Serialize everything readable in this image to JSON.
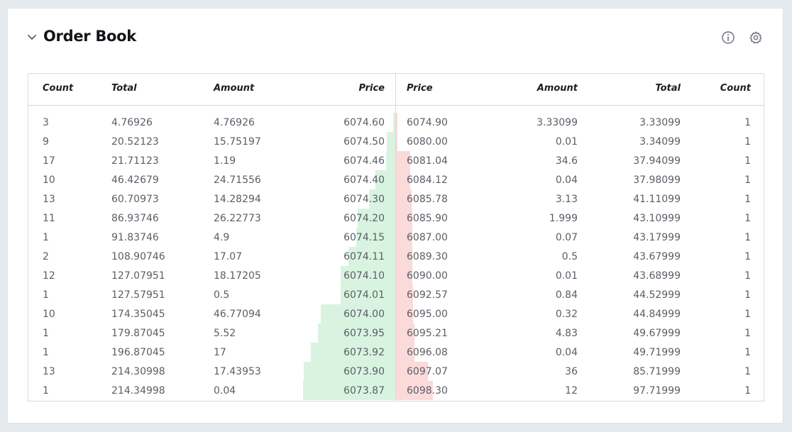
{
  "title": "Order Book",
  "icons": {
    "collapse": "chevron-down-icon",
    "info": "info-icon",
    "settings": "gear-icon"
  },
  "colors": {
    "bid_bar": "#d9f3e1",
    "ask_bar": "#fbdada",
    "accent": "#121418"
  },
  "bids": {
    "headers": [
      "Count",
      "Total",
      "Amount",
      "Price"
    ],
    "rows": [
      {
        "count": "3",
        "total": "4.76926",
        "amount": "4.76926",
        "price": "6074.60"
      },
      {
        "count": "9",
        "total": "20.52123",
        "amount": "15.75197",
        "price": "6074.50"
      },
      {
        "count": "17",
        "total": "21.71123",
        "amount": "1.19",
        "price": "6074.46"
      },
      {
        "count": "10",
        "total": "46.42679",
        "amount": "24.71556",
        "price": "6074.40"
      },
      {
        "count": "13",
        "total": "60.70973",
        "amount": "14.28294",
        "price": "6074.30"
      },
      {
        "count": "11",
        "total": "86.93746",
        "amount": "26.22773",
        "price": "6074.20"
      },
      {
        "count": "1",
        "total": "91.83746",
        "amount": "4.9",
        "price": "6074.15"
      },
      {
        "count": "2",
        "total": "108.90746",
        "amount": "17.07",
        "price": "6074.11"
      },
      {
        "count": "12",
        "total": "127.07951",
        "amount": "18.17205",
        "price": "6074.10"
      },
      {
        "count": "1",
        "total": "127.57951",
        "amount": "0.5",
        "price": "6074.01"
      },
      {
        "count": "10",
        "total": "174.35045",
        "amount": "46.77094",
        "price": "6074.00"
      },
      {
        "count": "1",
        "total": "179.87045",
        "amount": "5.52",
        "price": "6073.95"
      },
      {
        "count": "1",
        "total": "196.87045",
        "amount": "17",
        "price": "6073.92"
      },
      {
        "count": "13",
        "total": "214.30998",
        "amount": "17.43953",
        "price": "6073.90"
      },
      {
        "count": "1",
        "total": "214.34998",
        "amount": "0.04",
        "price": "6073.87"
      }
    ]
  },
  "asks": {
    "headers": [
      "Price",
      "Amount",
      "Total",
      "Count"
    ],
    "rows": [
      {
        "price": "6074.90",
        "amount": "3.33099",
        "total": "3.33099",
        "count": "1"
      },
      {
        "price": "6080.00",
        "amount": "0.01",
        "total": "3.34099",
        "count": "1"
      },
      {
        "price": "6081.04",
        "amount": "34.6",
        "total": "37.94099",
        "count": "1"
      },
      {
        "price": "6084.12",
        "amount": "0.04",
        "total": "37.98099",
        "count": "1"
      },
      {
        "price": "6085.78",
        "amount": "3.13",
        "total": "41.11099",
        "count": "1"
      },
      {
        "price": "6085.90",
        "amount": "1.999",
        "total": "43.10999",
        "count": "1"
      },
      {
        "price": "6087.00",
        "amount": "0.07",
        "total": "43.17999",
        "count": "1"
      },
      {
        "price": "6089.30",
        "amount": "0.5",
        "total": "43.67999",
        "count": "1"
      },
      {
        "price": "6090.00",
        "amount": "0.01",
        "total": "43.68999",
        "count": "1"
      },
      {
        "price": "6092.57",
        "amount": "0.84",
        "total": "44.52999",
        "count": "1"
      },
      {
        "price": "6095.00",
        "amount": "0.32",
        "total": "44.84999",
        "count": "1"
      },
      {
        "price": "6095.21",
        "amount": "4.83",
        "total": "49.67999",
        "count": "1"
      },
      {
        "price": "6096.08",
        "amount": "0.04",
        "total": "49.71999",
        "count": "1"
      },
      {
        "price": "6097.07",
        "amount": "36",
        "total": "85.71999",
        "count": "1"
      },
      {
        "price": "6098.30",
        "amount": "12",
        "total": "97.71999",
        "count": "1"
      }
    ]
  }
}
